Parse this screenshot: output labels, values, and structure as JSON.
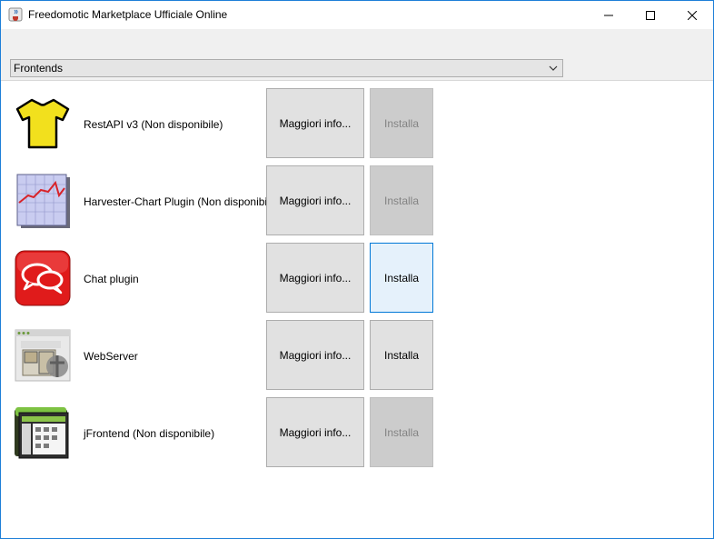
{
  "window": {
    "title": "Freedomotic Marketplace Ufficiale Online",
    "app_icon": "java-cup-icon",
    "controls": [
      "minimize-icon",
      "maximize-icon",
      "close-icon"
    ]
  },
  "category_select": {
    "selected": "Frontends",
    "icon": "chevron-down-icon"
  },
  "plugins": [
    {
      "name": "RestAPI v3 (Non disponibile)",
      "icon": "yellow-tshirt-icon",
      "info_label": "Maggiori info...",
      "install_label": "Installa",
      "install_state": "disabled"
    },
    {
      "name": "Harvester-Chart Plugin (Non disponibile)",
      "icon": "line-chart-icon",
      "info_label": "Maggiori info...",
      "install_label": "Installa",
      "install_state": "disabled"
    },
    {
      "name": "Chat plugin",
      "icon": "chat-bubbles-icon",
      "info_label": "Maggiori info...",
      "install_label": "Installa",
      "install_state": "focused"
    },
    {
      "name": "WebServer",
      "icon": "webserver-floorplan-icon",
      "info_label": "Maggiori info...",
      "install_label": "Installa",
      "install_state": "enabled"
    },
    {
      "name": "jFrontend (Non disponibile)",
      "icon": "frontend-window-icon",
      "info_label": "Maggiori info...",
      "install_label": "Installa",
      "install_state": "disabled"
    }
  ],
  "colors": {
    "window_border": "#1e7fd8",
    "focus_border": "#0078d7",
    "disabled_text": "#838383"
  }
}
